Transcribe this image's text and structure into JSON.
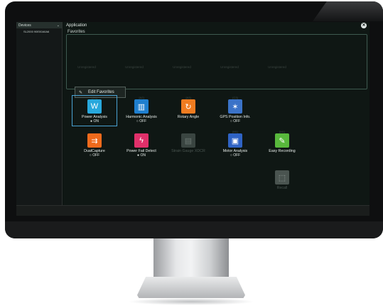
{
  "device_panel": {
    "header": "Devices",
    "device_name": "SL2000 90E00A0A6"
  },
  "app_panel": {
    "title": "Application",
    "favorites_title": "Favorites",
    "unregistered": [
      "Unregistered",
      "Unregistered",
      "Unregistered",
      "Unregistered",
      "Unregistered"
    ],
    "edit_favorites": "Edit Favorites"
  },
  "apps": [
    {
      "hotkey": "[C1]",
      "name": "Power Analysis",
      "status": "● ON",
      "color": "#28a8dc",
      "icon": "waveform-w-icon"
    },
    {
      "hotkey": "[A2]",
      "name": "Harmonic Analysis",
      "status": "○ OFF",
      "color": "#1f7fcf",
      "icon": "bar-chart-icon"
    },
    {
      "hotkey": "[A3]",
      "name": "Rotary Angle",
      "status": "",
      "color": "#f07c20",
      "icon": "rotary-icon"
    },
    {
      "hotkey": "[C3]",
      "name": "GPS Position Info.",
      "status": "○ OFF",
      "color": "#3b73c8",
      "icon": "satellite-icon"
    },
    {
      "hotkey": "",
      "name": "DualCapture",
      "status": "○ OFF",
      "color": "#ef6a1c",
      "icon": "capture-icon"
    },
    {
      "hotkey": "",
      "name": "Power Fail Detect",
      "status": "● ON",
      "color": "#e0306a",
      "icon": "power-fail-icon"
    },
    {
      "hotkey": "",
      "name": "Strain Gauge XDCR",
      "status": "",
      "color": "#3a4541",
      "icon": "strain-gauge-icon"
    },
    {
      "hotkey": "[M1]",
      "name": "Motor Analysis",
      "status": "○ OFF",
      "color": "#2f63c4",
      "icon": "motor-icon"
    },
    {
      "hotkey": "[M1]",
      "name": "Easy Recording",
      "status": "",
      "color": "#58b83c",
      "icon": "recording-icon"
    },
    {
      "hotkey": "",
      "name": "Recall",
      "status": "",
      "color": "#4a5450",
      "icon": "recall-icon"
    }
  ]
}
